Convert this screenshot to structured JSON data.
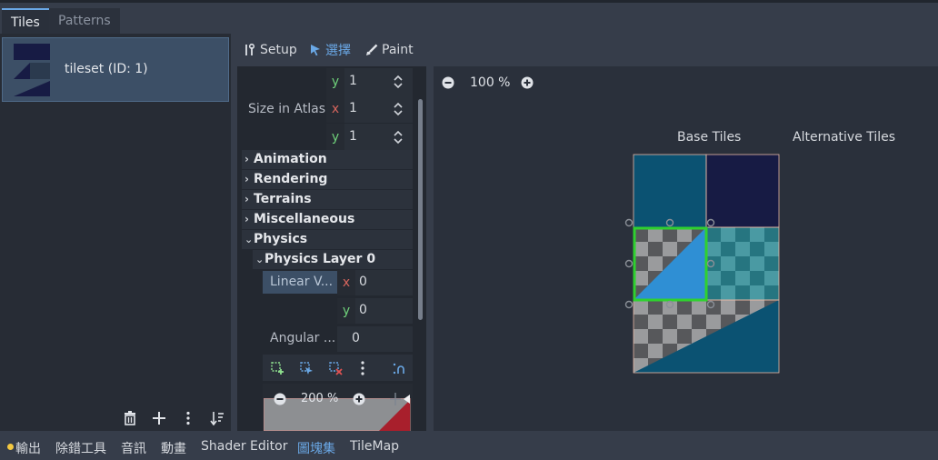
{
  "tabs": [
    {
      "label": "Tiles",
      "active": true
    },
    {
      "label": "Patterns",
      "active": false
    }
  ],
  "tileset_list": [
    {
      "label": "tileset (ID: 1)"
    }
  ],
  "mode_buttons": {
    "setup": "Setup",
    "select": "選擇",
    "paint": "Paint"
  },
  "inspector": {
    "size_y_top": {
      "axis": "y",
      "value": "1"
    },
    "size_in_atlas": {
      "label": "Size in Atlas",
      "x": "1",
      "y": "1"
    },
    "sections": [
      "Animation",
      "Rendering",
      "Terrains",
      "Miscellaneous",
      "Physics"
    ],
    "physics_layer": "Physics Layer 0",
    "linear_velocity": {
      "label": "Linear V...",
      "x": "0",
      "y": "0"
    },
    "angular": {
      "label": "Angular ...",
      "value": "0"
    },
    "mini_zoom": "200 %"
  },
  "viewport": {
    "zoom": "100 %",
    "base_tiles_label": "Base Tiles",
    "alternative_tiles_label": "Alternative Tiles"
  },
  "bottom_tabs": [
    "輸出",
    "除錯工具",
    "音訊",
    "動畫",
    "Shader Editor",
    "圖塊集",
    "TileMap"
  ],
  "colors": {
    "accent": "#6aa8e6",
    "selection": "#2fd12f",
    "tile_teal": "#0b5272",
    "tile_navy": "#171b44",
    "polygon_blue": "#2f8fd4",
    "warning_dot": "#f3c841",
    "axis_x": "#d6655d",
    "axis_y": "#6fd07a"
  }
}
